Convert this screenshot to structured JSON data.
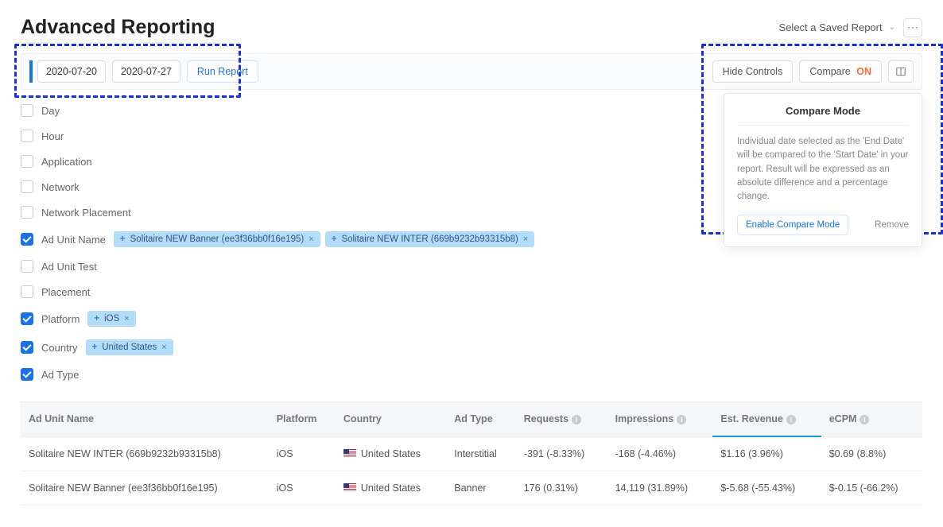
{
  "header": {
    "title": "Advanced Reporting",
    "saved_report_label": "Select a Saved Report"
  },
  "toolbar": {
    "start_date": "2020-07-20",
    "end_date": "2020-07-27",
    "run_report": "Run Report",
    "hide_controls": "Hide Controls",
    "compare_label": "Compare",
    "compare_state": "ON"
  },
  "filters": [
    {
      "label": "Day",
      "checked": false,
      "tags": []
    },
    {
      "label": "Hour",
      "checked": false,
      "tags": []
    },
    {
      "label": "Application",
      "checked": false,
      "tags": []
    },
    {
      "label": "Network",
      "checked": false,
      "tags": []
    },
    {
      "label": "Network Placement",
      "checked": false,
      "tags": []
    },
    {
      "label": "Ad Unit Name",
      "checked": true,
      "tags": [
        "Solitaire NEW Banner (ee3f36bb0f16e195)",
        "Solitaire NEW INTER (669b9232b93315b8)"
      ]
    },
    {
      "label": "Ad Unit Test",
      "checked": false,
      "tags": []
    },
    {
      "label": "Placement",
      "checked": false,
      "tags": []
    },
    {
      "label": "Platform",
      "checked": true,
      "tags": [
        "iOS"
      ]
    },
    {
      "label": "Country",
      "checked": true,
      "tags": [
        "United States"
      ]
    },
    {
      "label": "Ad Type",
      "checked": true,
      "tags": []
    }
  ],
  "popover": {
    "title": "Compare Mode",
    "body": "Individual date selected as the 'End Date' will be compared to the 'Start Date' in your report. Result will be expressed as an absolute difference and a percentage change.",
    "enable": "Enable Compare Mode",
    "remove": "Remove"
  },
  "table": {
    "columns": [
      "Ad Unit Name",
      "Platform",
      "Country",
      "Ad Type",
      "Requests",
      "Impressions",
      "Est. Revenue",
      "eCPM"
    ],
    "rows": [
      {
        "ad_unit": "Solitaire NEW INTER (669b9232b93315b8)",
        "platform": "iOS",
        "country": "United States",
        "ad_type": "Interstitial",
        "requests": "-391 (-8.33%)",
        "impressions": "-168 (-4.46%)",
        "revenue": "$1.16 (3.96%)",
        "ecpm": "$0.69 (8.8%)"
      },
      {
        "ad_unit": "Solitaire NEW Banner (ee3f36bb0f16e195)",
        "platform": "iOS",
        "country": "United States",
        "ad_type": "Banner",
        "requests": "176 (0.31%)",
        "impressions": "14,119 (31.89%)",
        "revenue": "$-5.68 (-55.43%)",
        "ecpm": "$-0.15 (-66.2%)"
      }
    ]
  }
}
